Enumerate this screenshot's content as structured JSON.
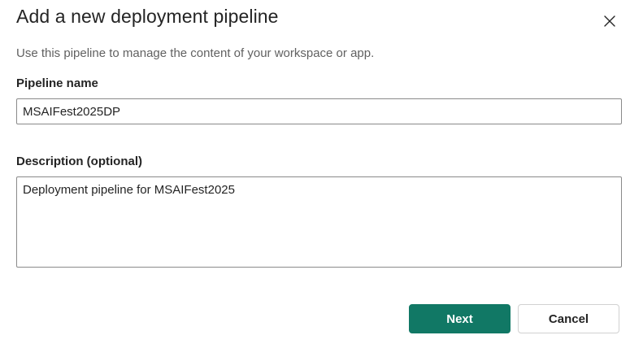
{
  "dialog": {
    "title": "Add a new deployment pipeline",
    "subtitle": "Use this pipeline to manage the content of your workspace or app.",
    "close_icon": "close-icon"
  },
  "form": {
    "pipeline_name_label": "Pipeline name",
    "pipeline_name_value": "MSAIFest2025DP",
    "description_label": "Description (optional)",
    "description_value": "Deployment pipeline for MSAIFest2025"
  },
  "actions": {
    "next_label": "Next",
    "cancel_label": "Cancel"
  },
  "colors": {
    "primary": "#117865",
    "text": "#242424",
    "subtext": "#616161",
    "border": "#8a8a8a"
  }
}
